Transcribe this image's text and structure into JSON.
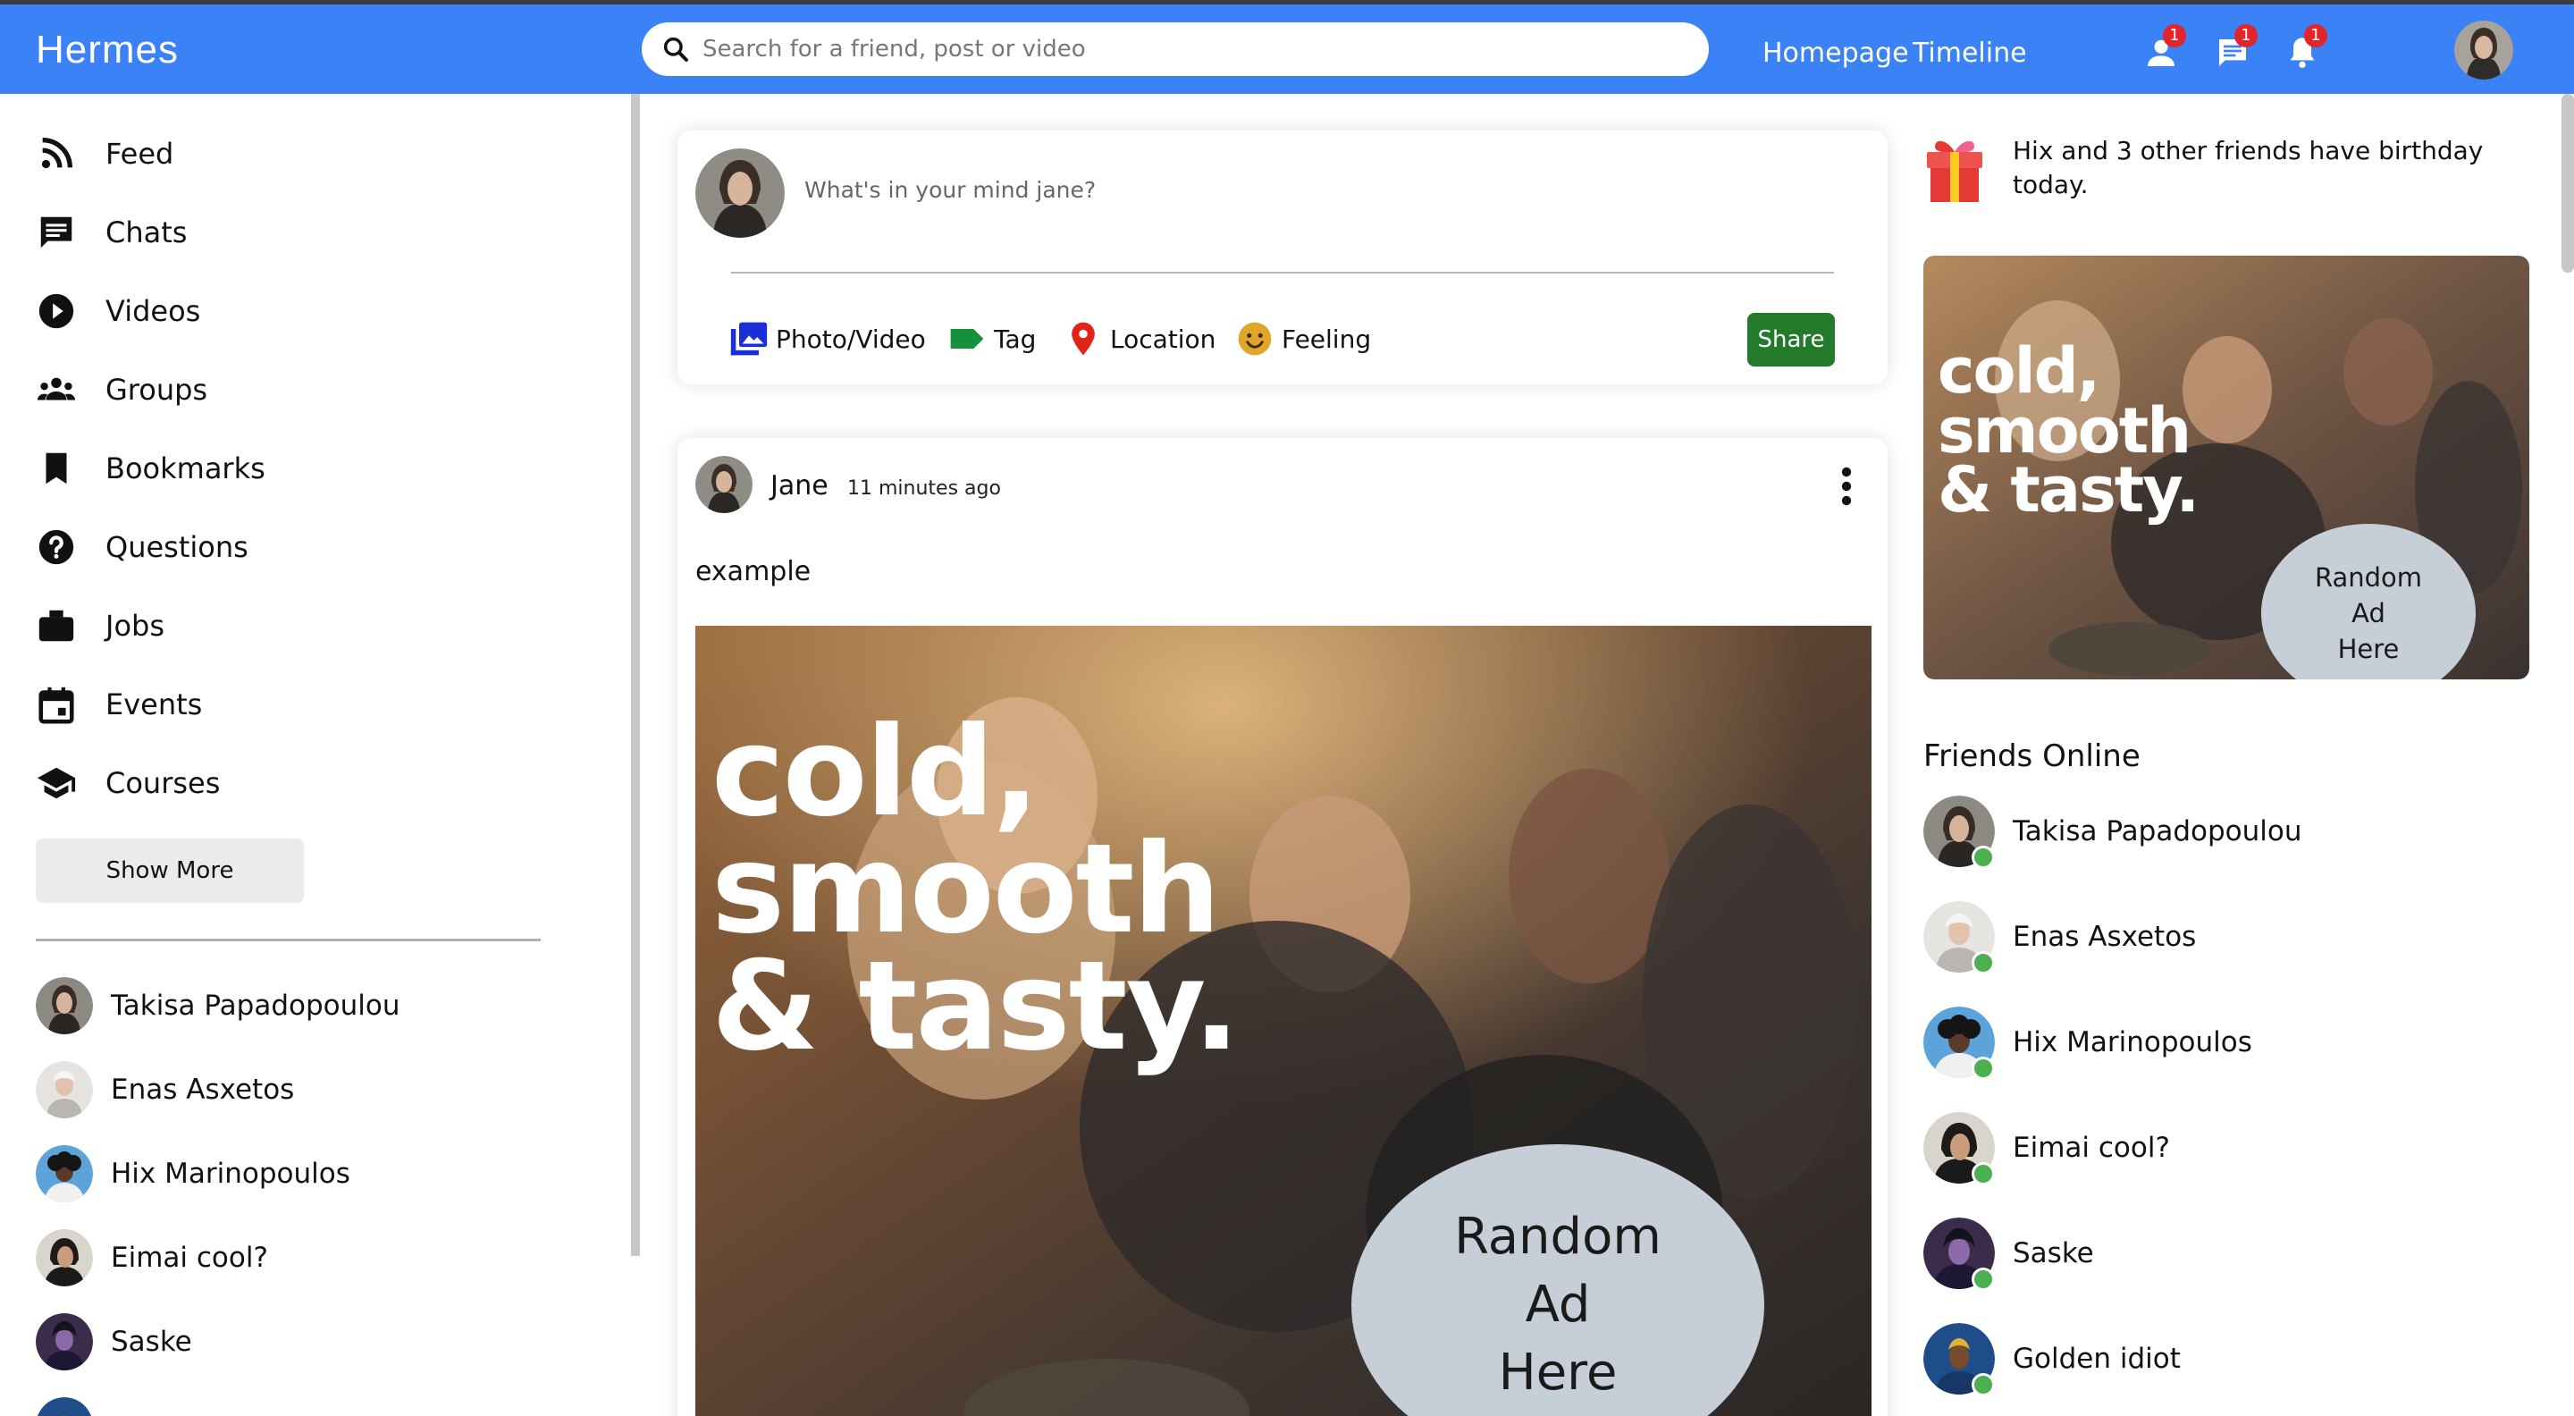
{
  "app": {
    "logo": "Hermes"
  },
  "search": {
    "placeholder": "Search for a friend, post or video"
  },
  "topbar": {
    "links": [
      "Homepage",
      "Timeline"
    ],
    "badges": {
      "friends": "1",
      "messages": "1",
      "notifications": "1"
    }
  },
  "sidebar": {
    "items": [
      {
        "label": "Feed",
        "icon": "rss-feed-icon"
      },
      {
        "label": "Chats",
        "icon": "chat-icon"
      },
      {
        "label": "Videos",
        "icon": "play-circle-icon"
      },
      {
        "label": "Groups",
        "icon": "groups-icon"
      },
      {
        "label": "Bookmarks",
        "icon": "bookmark-icon"
      },
      {
        "label": "Questions",
        "icon": "help-circle-icon"
      },
      {
        "label": "Jobs",
        "icon": "briefcase-icon"
      },
      {
        "label": "Events",
        "icon": "calendar-event-icon"
      },
      {
        "label": "Courses",
        "icon": "graduation-cap-icon"
      }
    ],
    "show_more": "Show More",
    "friends": [
      "Takisa Papadopoulou",
      "Enas Asxetos",
      "Hix Marinopoulos",
      "Eimai cool?",
      "Saske"
    ]
  },
  "share": {
    "placeholder": "What's in your mind jane?",
    "options": [
      "Photo/Video",
      "Tag",
      "Location",
      "Feeling"
    ],
    "button": "Share"
  },
  "post": {
    "author": "Jane",
    "time": "11 minutes ago",
    "text": "example",
    "ad": {
      "slogan_lines": [
        "cold,",
        "smooth",
        "& tasty."
      ],
      "bubble_lines": [
        "Random",
        "Ad",
        "Here"
      ]
    }
  },
  "rightbar": {
    "birthday": "Hix and 3 other friends have birthday today.",
    "ad": {
      "slogan_lines": [
        "cold,",
        "smooth",
        "& tasty."
      ],
      "bubble_lines": [
        "Random",
        "Ad",
        "Here"
      ]
    },
    "friends_title": "Friends Online",
    "online": [
      "Takisa Papadopoulou",
      "Enas Asxetos",
      "Hix Marinopoulos",
      "Eimai cool?",
      "Saske",
      "Golden idiot"
    ]
  },
  "colors": {
    "primary": "#3b82f6",
    "share_button": "#237a2a",
    "online_dot": "#4caf50",
    "badge": "#e3242b"
  }
}
